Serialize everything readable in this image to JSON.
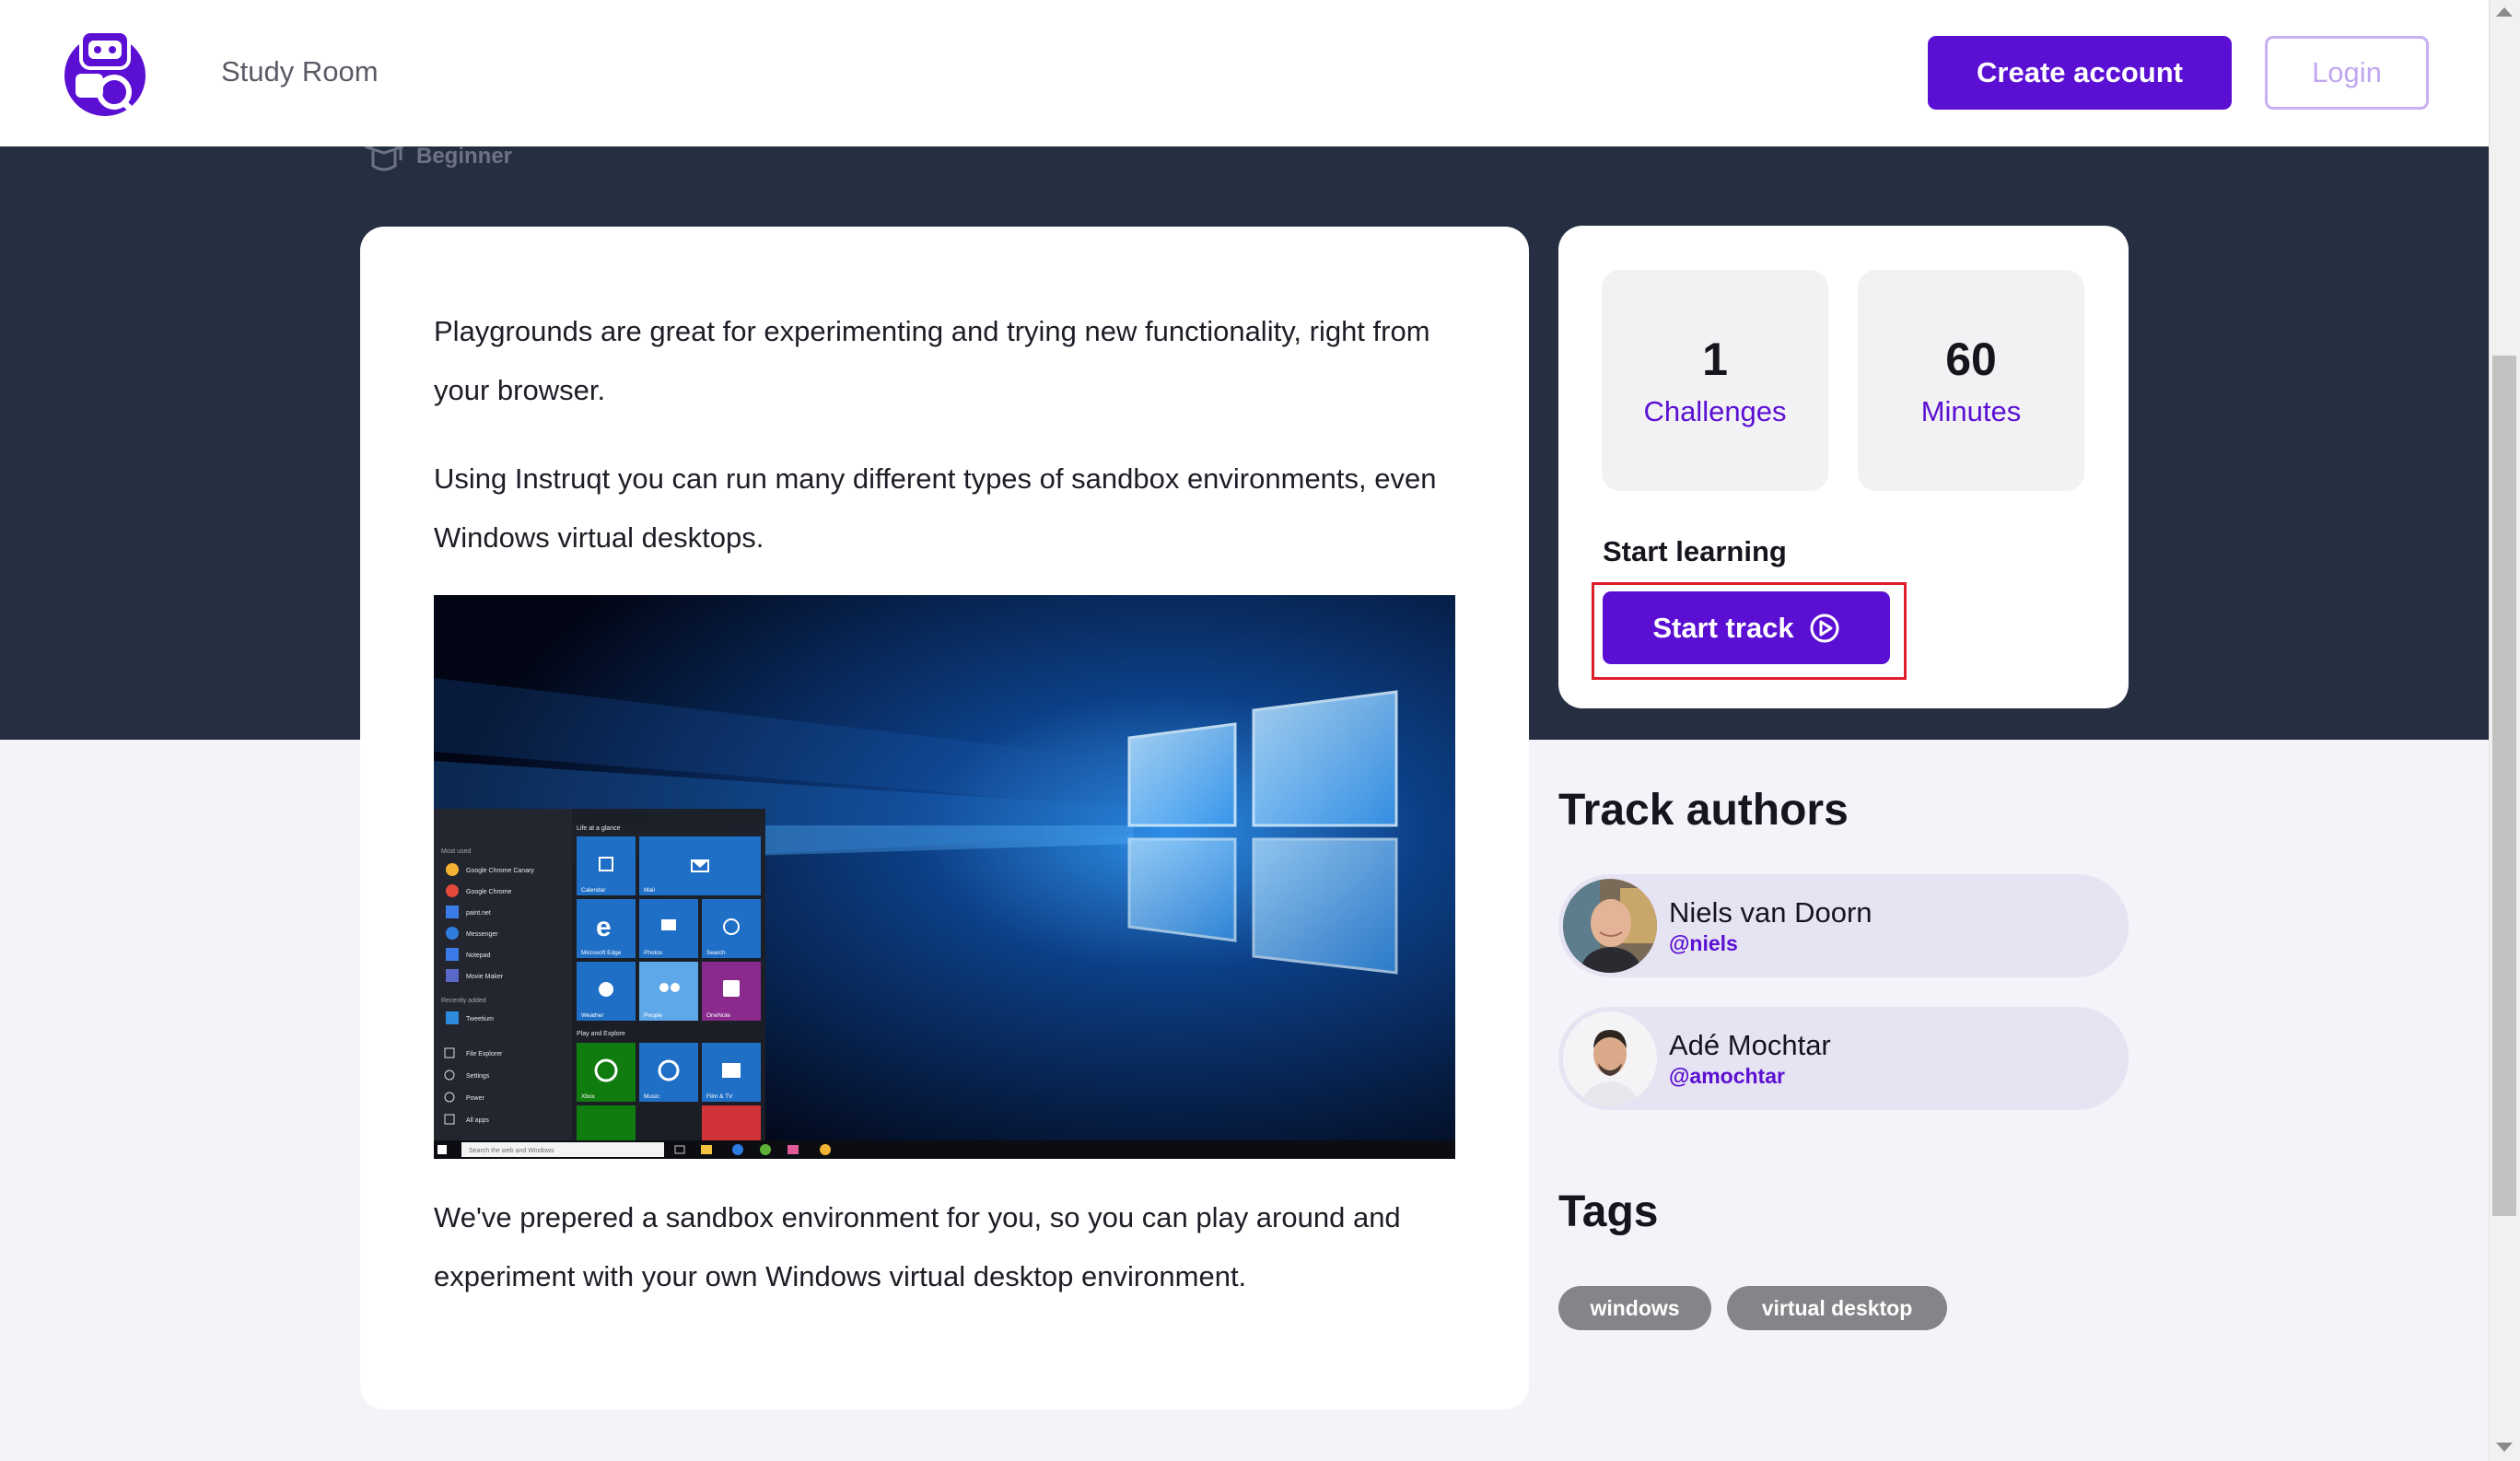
{
  "header": {
    "brand": "Study Room",
    "create_account_label": "Create account",
    "login_label": "Login"
  },
  "level": "Beginner",
  "content": {
    "paragraph_1": "Playgrounds are great for experimenting and trying new functionality, right from your browser.",
    "paragraph_2": "Using Instruqt you can run many different types of sandbox environments, even Windows virtual desktops.",
    "paragraph_3": "We've prepered a sandbox environment for you, so you can play around and experiment with your own Windows virtual desktop environment.",
    "screenshot": {
      "taskbar_search_placeholder": "Search the web and Windows",
      "start_menu": {
        "most_used_heading": "Most used",
        "most_used": [
          "Google Chrome Canary",
          "Google Chrome",
          "paint.net",
          "Messenger",
          "Notepad",
          "Movie Maker"
        ],
        "recently_added_heading": "Recently added",
        "recently_added": [
          "Tweetium"
        ],
        "bottom_items": [
          "File Explorer",
          "Settings",
          "Power",
          "All apps"
        ],
        "life_heading": "Life at a glance",
        "play_heading": "Play and Explore",
        "tiles": [
          "Calendar",
          "Mail",
          "Microsoft Edge",
          "Photos",
          "Search",
          "Weather",
          "People",
          "OneNote",
          "Xbox",
          "Music",
          "Film & TV"
        ]
      }
    }
  },
  "sidebar": {
    "stats": [
      {
        "value": "1",
        "label": "Challenges"
      },
      {
        "value": "60",
        "label": "Minutes"
      }
    ],
    "start_learning_label": "Start learning",
    "start_track_label": "Start track"
  },
  "authors": {
    "heading": "Track authors",
    "items": [
      {
        "name": "Niels van Doorn",
        "handle": "@niels"
      },
      {
        "name": "Adé Mochtar",
        "handle": "@amochtar"
      }
    ]
  },
  "tags": {
    "heading": "Tags",
    "items": [
      "windows",
      "virtual desktop"
    ]
  },
  "colors": {
    "accent": "#5a0fd3",
    "hero_background": "#262f41",
    "highlight_border": "#e01d2b"
  }
}
